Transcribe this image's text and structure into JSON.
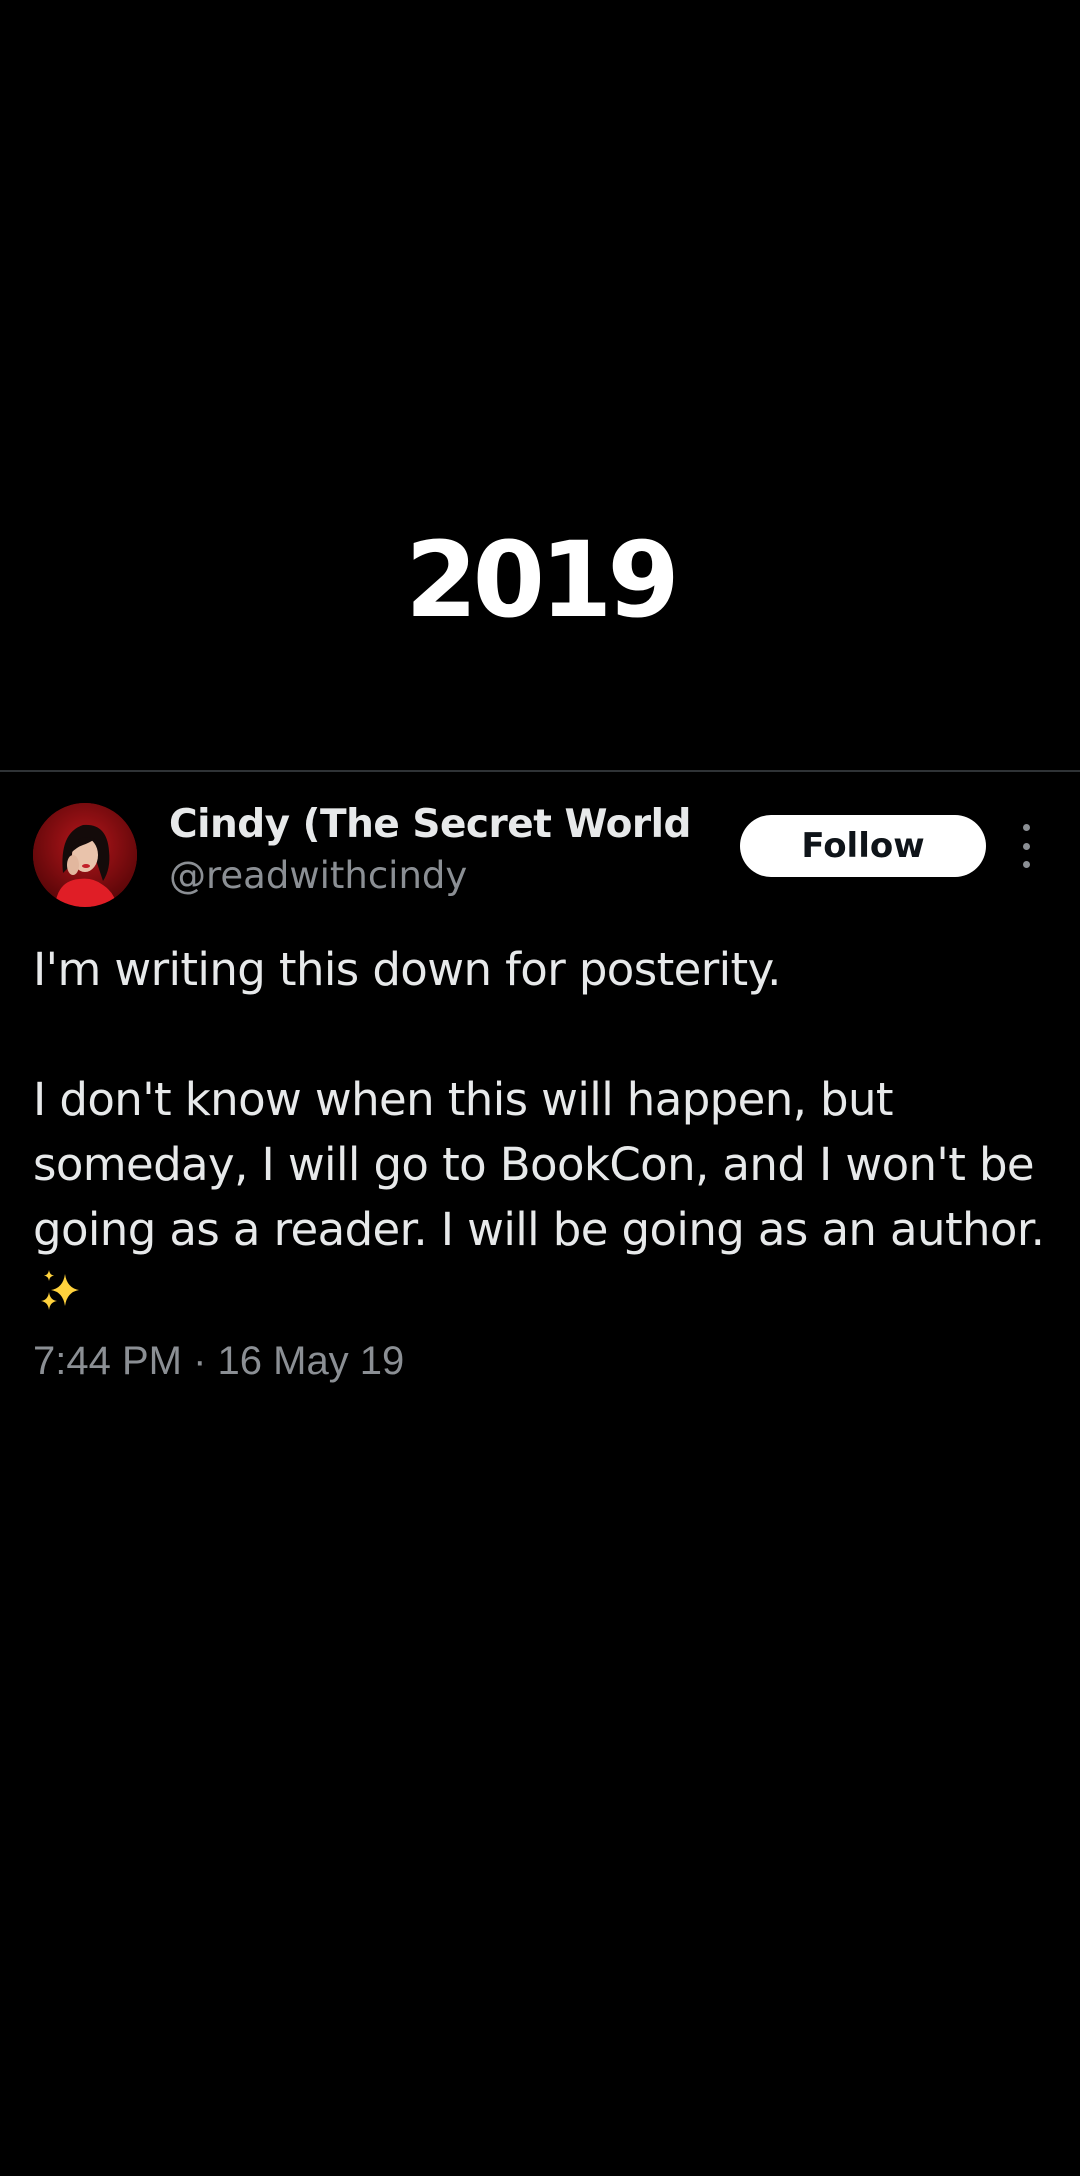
{
  "caption": {
    "year": "2019"
  },
  "tweet": {
    "author": {
      "display_name": "Cindy (The Secret World...",
      "handle": "@readwithcindy",
      "avatar_icon": "profile-photo-avatar"
    },
    "follow_label": "Follow",
    "more_icon": "more-options-icon",
    "text": {
      "line1": "I'm writing this down for posterity.",
      "line2": "I don't know when this will happen, but someday, I will go to BookCon, and I won't be going as a reader. I will be going as an author.",
      "emoji": "sparkles-icon"
    },
    "timestamp": "7:44 PM · 16 May 19"
  },
  "colors": {
    "background": "#000000",
    "text_primary": "#e7e9ea",
    "text_secondary": "#8b8f94",
    "follow_bg": "#ffffff",
    "divider": "#2f3336",
    "sparkle": "#ffd23d"
  }
}
